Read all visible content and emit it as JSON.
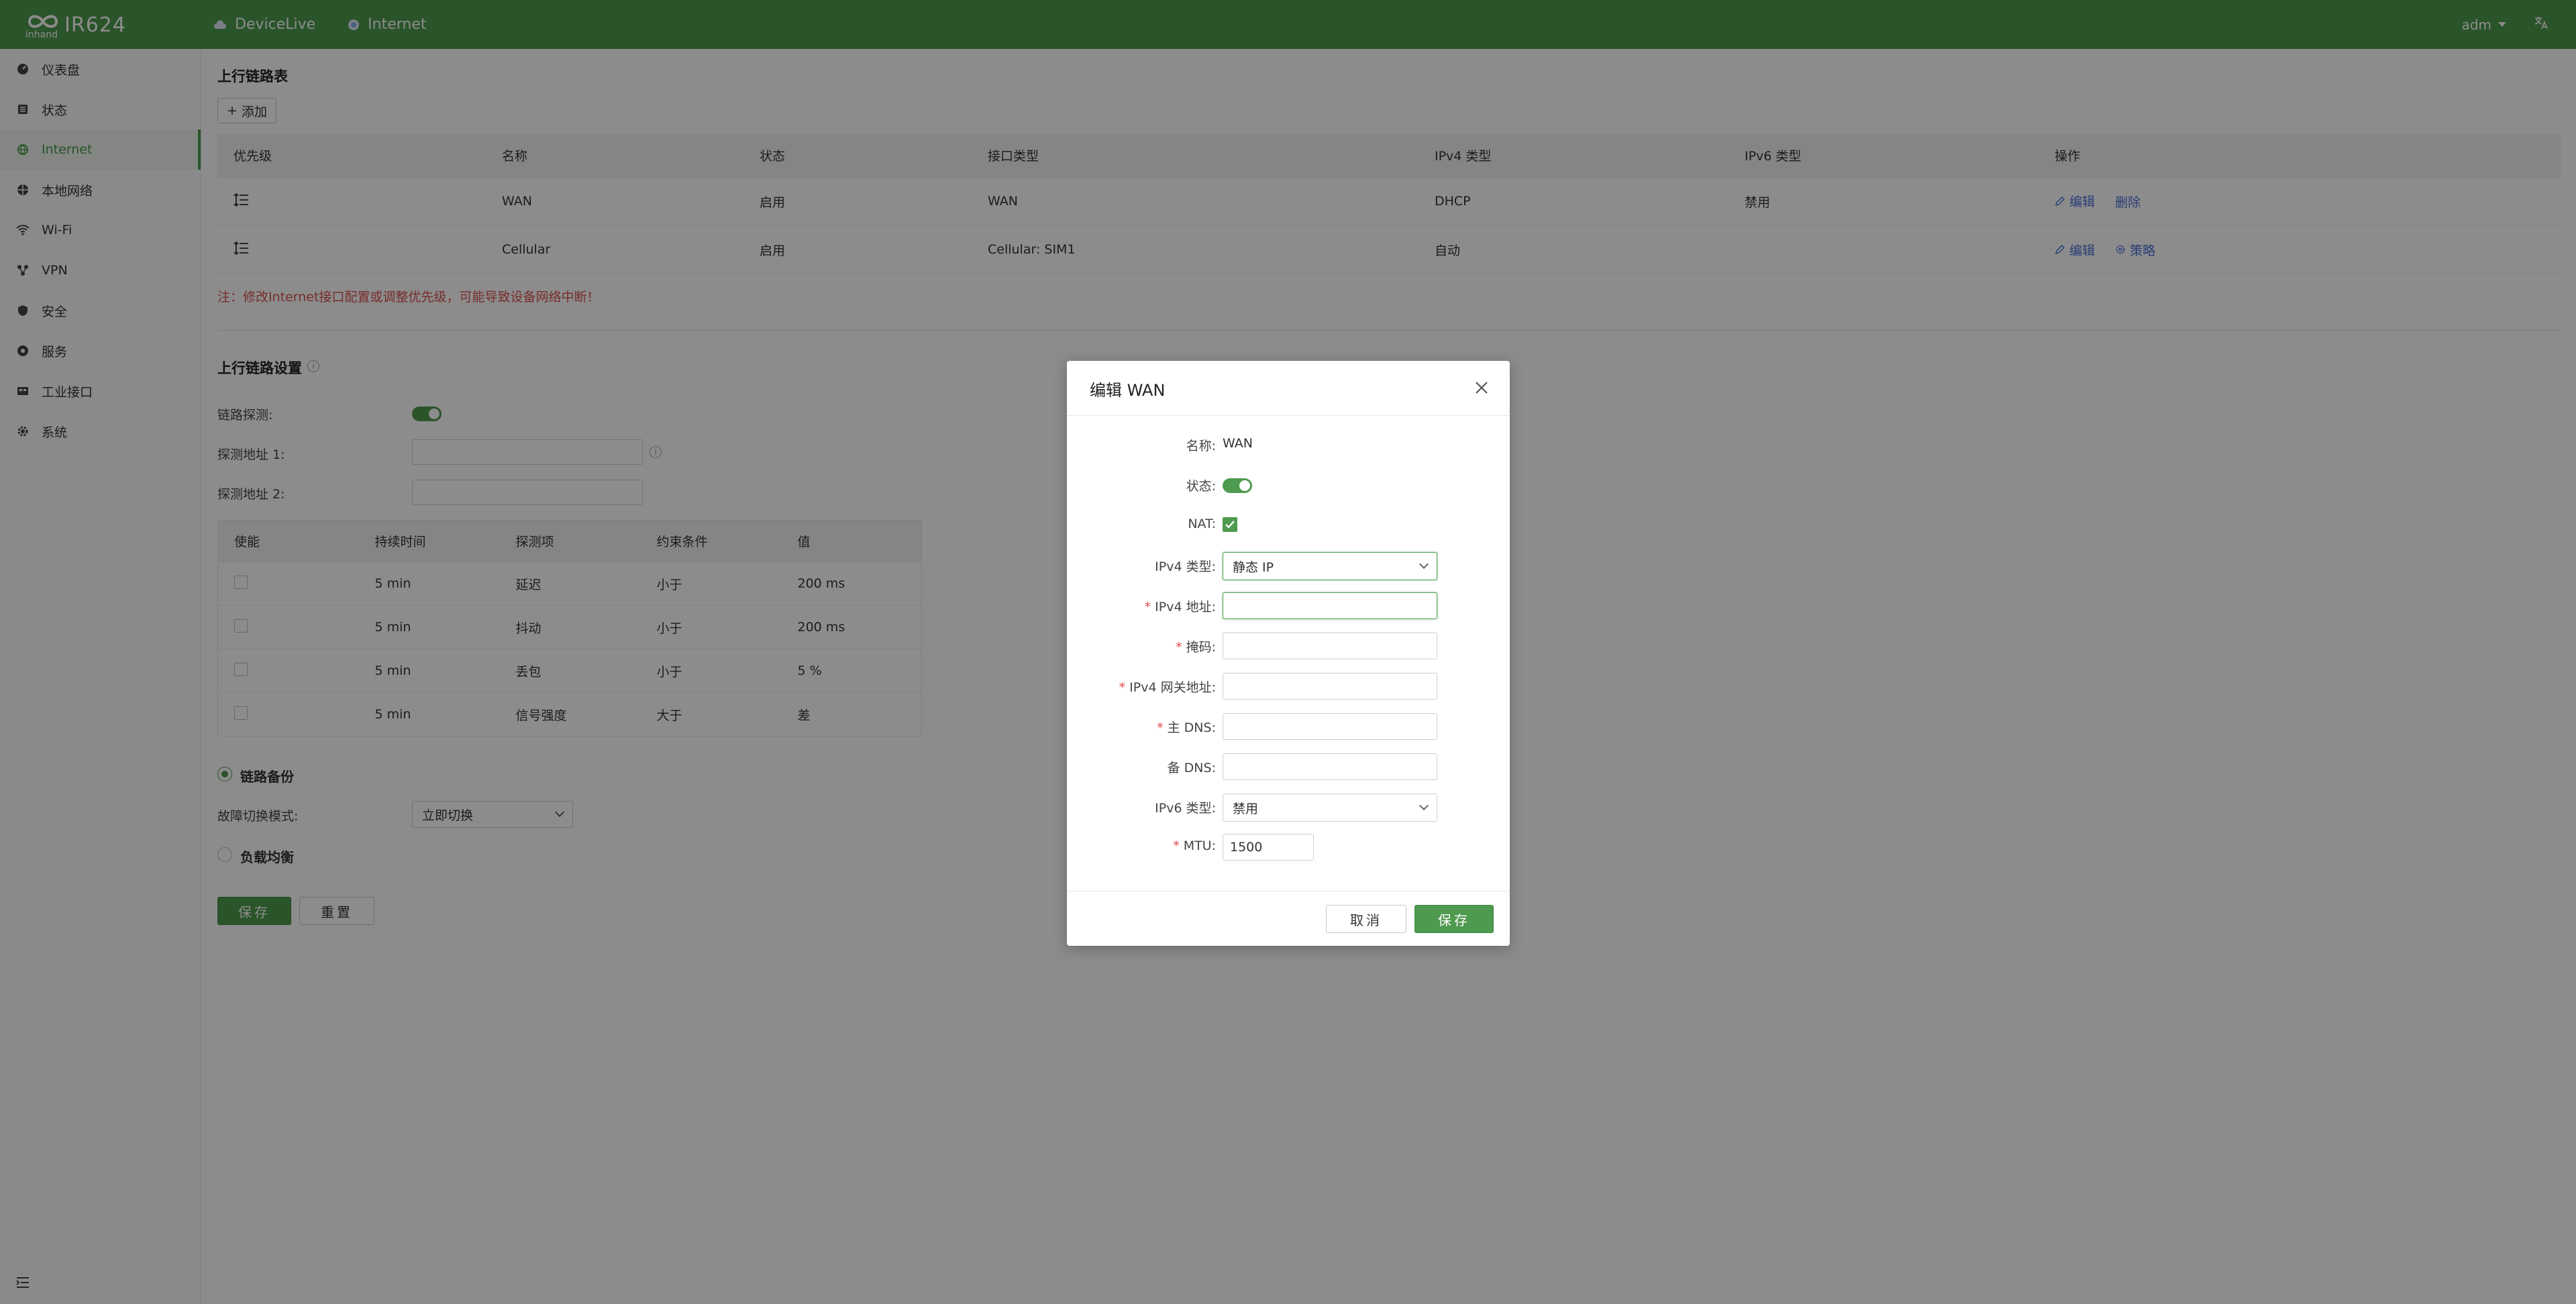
{
  "app": {
    "title": "IR624",
    "logo_text": "inhand"
  },
  "top_nav": [
    {
      "label": "DeviceLive",
      "icon": "cloud-icon"
    },
    {
      "label": "Internet",
      "icon": "globe-icon"
    }
  ],
  "header": {
    "user": "adm",
    "lang_icon": "translate-icon"
  },
  "sidebar": {
    "items": [
      {
        "label": "仪表盘",
        "icon": "dashboard-icon"
      },
      {
        "label": "状态",
        "icon": "status-icon"
      },
      {
        "label": "Internet",
        "icon": "internet-icon",
        "active": true
      },
      {
        "label": "本地网络",
        "icon": "local-network-icon"
      },
      {
        "label": "Wi-Fi",
        "icon": "wifi-icon"
      },
      {
        "label": "VPN",
        "icon": "vpn-icon"
      },
      {
        "label": "安全",
        "icon": "shield-icon"
      },
      {
        "label": "服务",
        "icon": "service-icon"
      },
      {
        "label": "工业接口",
        "icon": "industrial-icon"
      },
      {
        "label": "系统",
        "icon": "gear-icon"
      }
    ]
  },
  "uplink_table": {
    "title": "上行链路表",
    "add_label": "添加",
    "columns": [
      "优先级",
      "名称",
      "状态",
      "接口类型",
      "IPv4 类型",
      "IPv6 类型",
      "操作"
    ],
    "rows": [
      {
        "name": "WAN",
        "status": "启用",
        "iface": "WAN",
        "ipv4": "DHCP",
        "ipv6": "禁用",
        "actions": [
          "编辑",
          "删除"
        ]
      },
      {
        "name": "Cellular",
        "status": "启用",
        "iface": "Cellular: SIM1",
        "ipv4": "自动",
        "ipv6": "",
        "actions": [
          "编辑",
          "策略"
        ]
      }
    ],
    "note": "注：修改Internet接口配置或调整优先级，可能导致设备网络中断！"
  },
  "uplink_settings": {
    "title": "上行链路设置",
    "probe_label": "链路探测:",
    "probe_addr1_label": "探测地址 1:",
    "probe_addr2_label": "探测地址 2:",
    "probe_addr1_value": "",
    "probe_addr2_value": "",
    "probe_columns": [
      "使能",
      "持续时间",
      "探测项",
      "约束条件",
      "值"
    ],
    "probe_rows": [
      {
        "duration": "5 min",
        "item": "延迟",
        "cond": "小于",
        "value": "200 ms"
      },
      {
        "duration": "5 min",
        "item": "抖动",
        "cond": "小于",
        "value": "200 ms"
      },
      {
        "duration": "5 min",
        "item": "丢包",
        "cond": "小于",
        "value": "5 %"
      },
      {
        "duration": "5 min",
        "item": "信号强度",
        "cond": "大于",
        "value": "差"
      }
    ],
    "backup_label": "链路备份",
    "failover_label": "故障切换模式:",
    "failover_value": "立即切换",
    "balance_label": "负载均衡",
    "save_label": "保存",
    "reset_label": "重置"
  },
  "modal": {
    "title": "编辑 WAN",
    "name_label": "名称:",
    "name_value": "WAN",
    "status_label": "状态:",
    "nat_label": "NAT:",
    "ipv4_type_label": "IPv4 类型:",
    "ipv4_type_value": "静态 IP",
    "ipv4_addr_label": "IPv4 地址:",
    "ipv4_addr_value": "",
    "mask_label": "掩码:",
    "mask_value": "",
    "gateway_label": "IPv4 网关地址:",
    "gateway_value": "",
    "dns1_label": "主 DNS:",
    "dns1_value": "",
    "dns2_label": "备 DNS:",
    "dns2_value": "",
    "ipv6_type_label": "IPv6 类型:",
    "ipv6_type_value": "禁用",
    "mtu_label": "MTU:",
    "mtu_value": "1500",
    "cancel_label": "取消",
    "save_label": "保存"
  },
  "colors": {
    "brand": "#4e9a4e",
    "link": "#4a6fd8",
    "warning": "#d9534f",
    "required": "#e5484d"
  }
}
